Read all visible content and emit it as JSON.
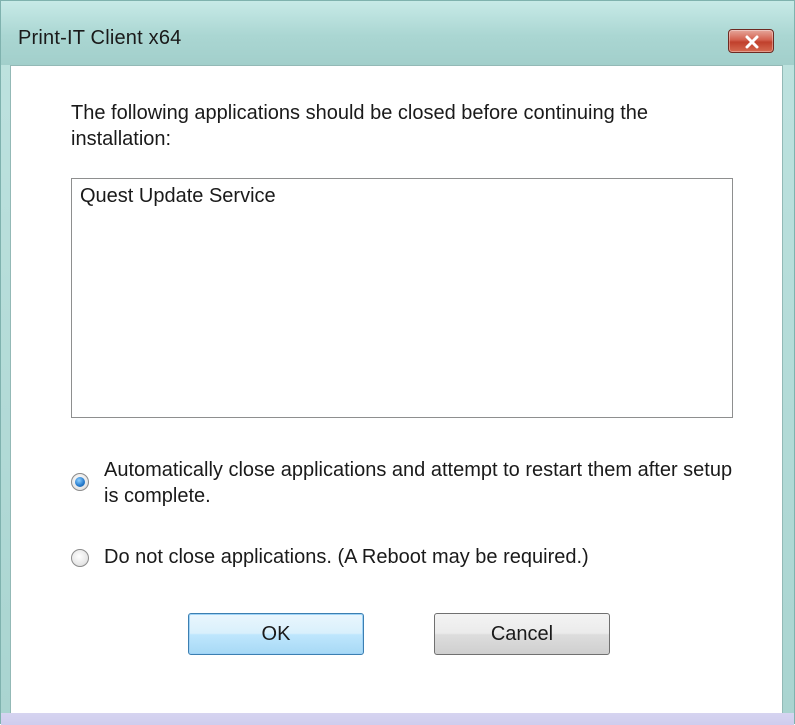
{
  "window": {
    "title": "Print-IT Client x64",
    "close_icon": "close-icon",
    "accent_color": "#aad6d2",
    "close_color": "#c7412d"
  },
  "dialog": {
    "message": "The following applications should be closed before continuing the installation:",
    "applications": [
      "Quest Update Service"
    ],
    "options": [
      {
        "label": "Automatically close applications and attempt to restart them after setup is complete.",
        "selected": true
      },
      {
        "label": "Do not close applications. (A Reboot may be required.)",
        "selected": false
      }
    ],
    "buttons": {
      "ok_label": "OK",
      "cancel_label": "Cancel"
    }
  }
}
